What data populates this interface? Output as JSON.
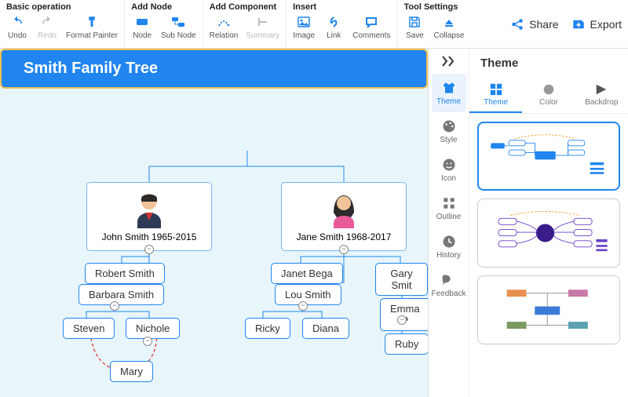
{
  "toolbar": {
    "groups": [
      {
        "title": "Basic operation",
        "items": [
          {
            "name": "undo",
            "label": "Undo",
            "color": "#2085ee"
          },
          {
            "name": "redo",
            "label": "Redo",
            "color": "#bbb",
            "disabled": true
          },
          {
            "name": "format-painter",
            "label": "Format Painter",
            "color": "#2085ee"
          }
        ]
      },
      {
        "title": "Add Node",
        "items": [
          {
            "name": "node",
            "label": "Node",
            "color": "#2085ee"
          },
          {
            "name": "sub-node",
            "label": "Sub Node",
            "color": "#2085ee"
          }
        ]
      },
      {
        "title": "Add Component",
        "items": [
          {
            "name": "relation",
            "label": "Relation",
            "color": "#2085ee"
          },
          {
            "name": "summary",
            "label": "Summary",
            "color": "#bbb",
            "disabled": true
          }
        ]
      },
      {
        "title": "Insert",
        "items": [
          {
            "name": "image",
            "label": "Image",
            "color": "#2085ee"
          },
          {
            "name": "link",
            "label": "Link",
            "color": "#2085ee"
          },
          {
            "name": "comments",
            "label": "Comments",
            "color": "#2085ee"
          }
        ]
      },
      {
        "title": "Tool Settings",
        "items": [
          {
            "name": "save",
            "label": "Save",
            "color": "#2085ee"
          },
          {
            "name": "collapse",
            "label": "Collapse",
            "color": "#2085ee"
          }
        ]
      }
    ],
    "share": "Share",
    "export": "Export"
  },
  "diagram": {
    "root": "Smith Family Tree",
    "p1_name": "John Smith 1965-2015",
    "p2_name": "Jane Smith 1968-2017",
    "c1": "Robert Smith",
    "c2": "Barbara Smith",
    "c3": "Steven",
    "c4": "Nichole",
    "c5": "Mary",
    "d1": "Janet Bega",
    "d2": "Lou Smith",
    "d3": "Ricky",
    "d4": "Diana",
    "e1": "Gary Smit",
    "e2": "Emma P",
    "e3": "Ruby"
  },
  "side": {
    "title": "Theme",
    "tabs": [
      {
        "name": "theme",
        "label": "Theme",
        "active": true
      },
      {
        "name": "style",
        "label": "Style"
      },
      {
        "name": "icon",
        "label": "Icon"
      },
      {
        "name": "outline",
        "label": "Outline"
      },
      {
        "name": "history",
        "label": "History"
      },
      {
        "name": "feedback",
        "label": "Feedback"
      }
    ],
    "subtabs": [
      {
        "name": "theme",
        "label": "Theme",
        "active": true
      },
      {
        "name": "color",
        "label": "Color"
      },
      {
        "name": "backdrop",
        "label": "Backdrop"
      }
    ]
  }
}
